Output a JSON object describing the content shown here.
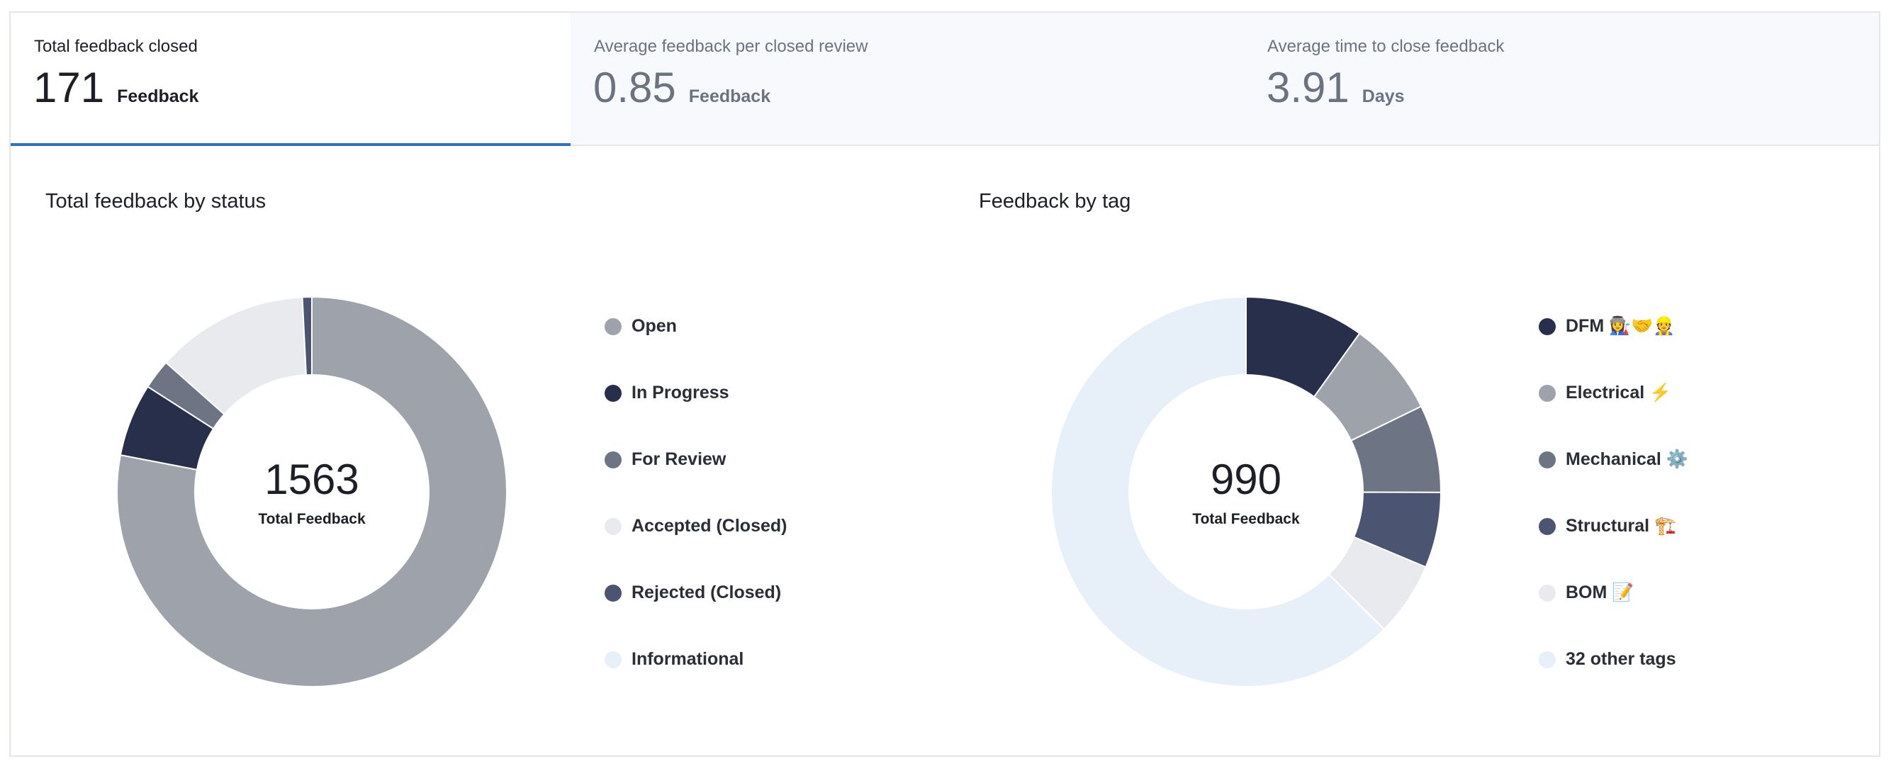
{
  "stats": [
    {
      "label": "Total feedback closed",
      "value": "171",
      "unit": "Feedback"
    },
    {
      "label": "Average feedback per closed review",
      "value": "0.85",
      "unit": "Feedback"
    },
    {
      "label": "Average time to close feedback",
      "value": "3.91",
      "unit": "Days"
    }
  ],
  "charts": {
    "status": {
      "title": "Total feedback by status",
      "total": "1563",
      "total_label": "Total Feedback"
    },
    "tag": {
      "title": "Feedback by tag",
      "total": "990",
      "total_label": "Total Feedback"
    }
  },
  "colors": {
    "accent": "#2f6fc8",
    "border": "#e3e6eb"
  },
  "chart_data": [
    {
      "type": "pie",
      "title": "Total feedback by status",
      "center_value": 1563,
      "center_label": "Total Feedback",
      "legend_position": "right",
      "labels": [
        "Open",
        "In Progress",
        "For Review",
        "Accepted (Closed)",
        "Rejected (Closed)",
        "Informational"
      ],
      "colors": [
        "#9ea3ab",
        "#272f4a",
        "#6d7584",
        "#e9eaee",
        "#4b5470",
        "#e7eff9"
      ],
      "values": [
        1200,
        93,
        38,
        195,
        12,
        0
      ]
    },
    {
      "type": "pie",
      "title": "Feedback by tag",
      "center_value": 990,
      "center_label": "Total Feedback",
      "legend_position": "right",
      "labels": [
        "DFM 👩‍🏭🤝👷",
        "Electrical ⚡",
        "Mechanical ⚙️",
        "Structural 🏗️",
        "BOM 📝",
        "32 other tags"
      ],
      "colors": [
        "#272f4a",
        "#9ea3ab",
        "#6d7584",
        "#4b5470",
        "#e9eaee",
        "#e7eff9"
      ],
      "values": [
        98,
        78,
        72,
        62,
        61,
        619
      ]
    }
  ]
}
